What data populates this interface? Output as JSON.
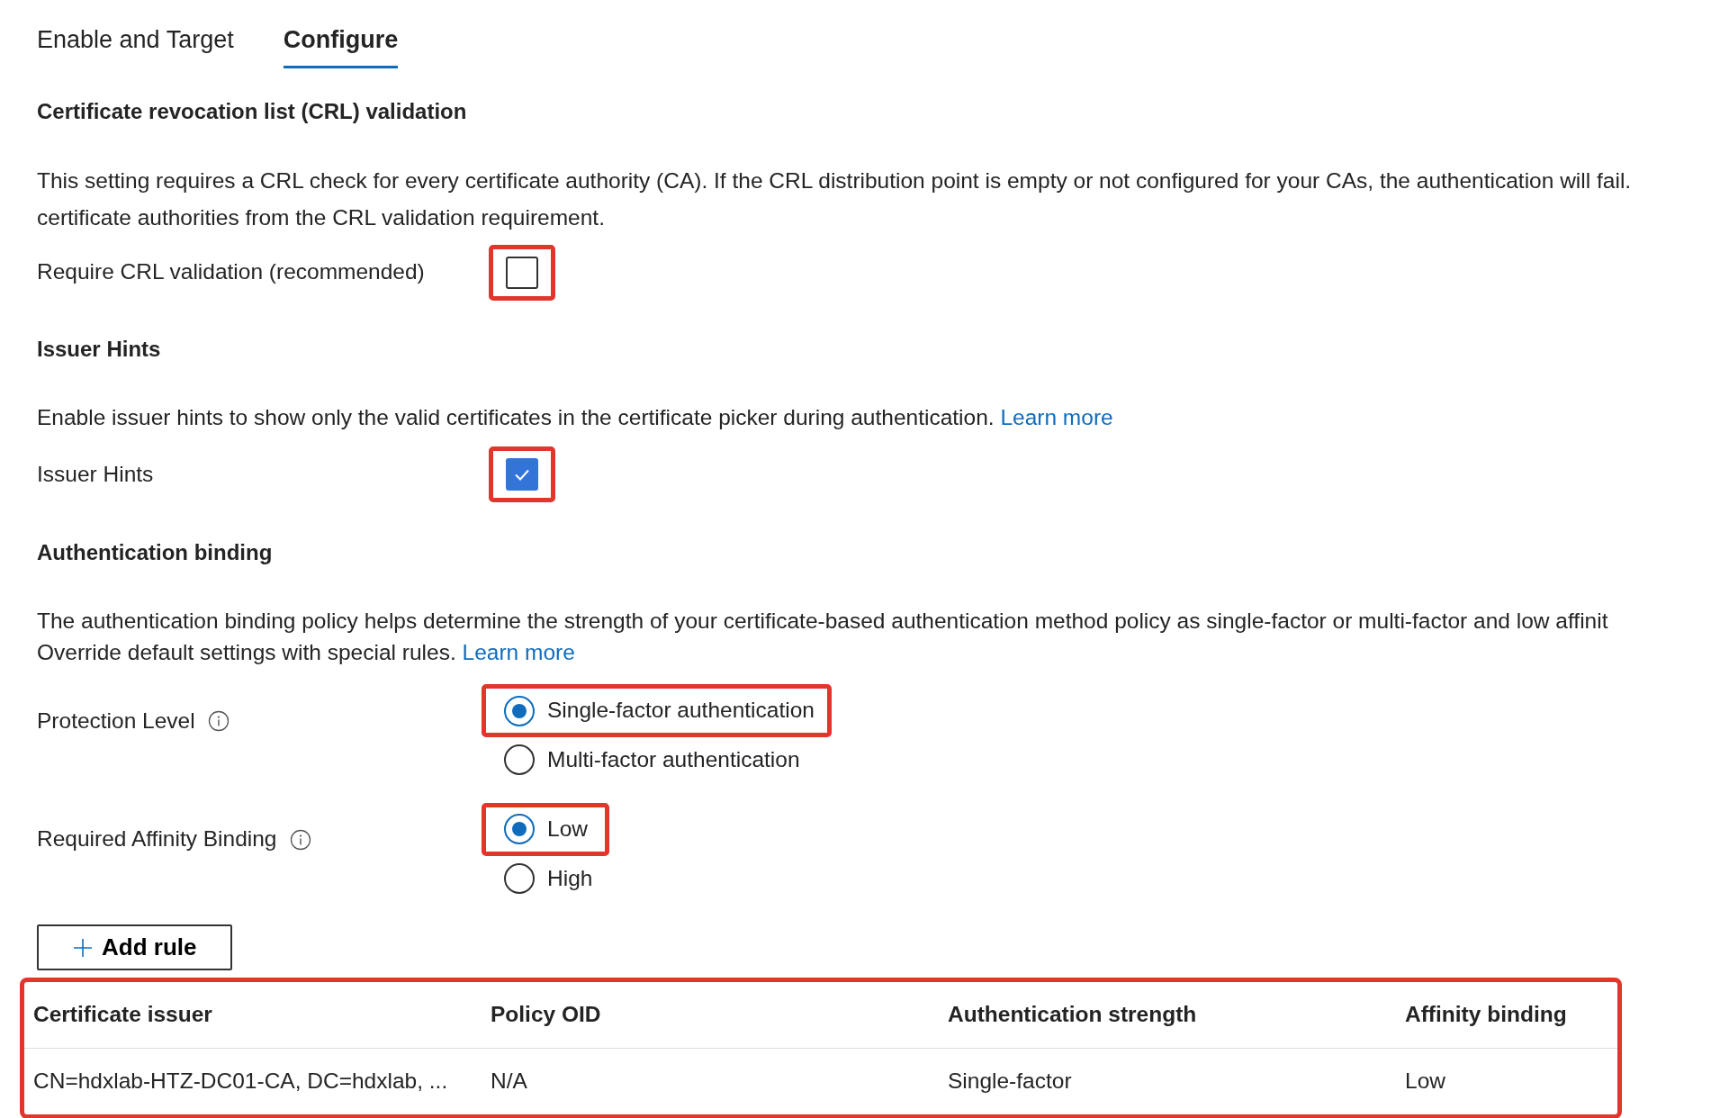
{
  "tabs": [
    {
      "label": "Enable and Target",
      "selected": false
    },
    {
      "label": "Configure",
      "selected": true
    }
  ],
  "crl": {
    "heading": "Certificate revocation list (CRL) validation",
    "lines": [
      "This setting requires a CRL check for every certificate authority (CA). If the CRL distribution point is empty or not configured for your CAs, the authentication will fail.",
      "certificate authorities from the CRL validation requirement."
    ],
    "label": "Require CRL validation (recommended)",
    "checked": false,
    "highlighted": true
  },
  "issuer_hints": {
    "heading": "Issuer Hints",
    "text": "Enable issuer hints to show only the valid certificates in the certificate picker during authentication.",
    "link": "Learn more",
    "label": "Issuer Hints",
    "checked": true,
    "highlighted": true
  },
  "binding": {
    "heading": "Authentication binding",
    "lines": [
      "The authentication binding policy helps determine the strength of your certificate-based authentication method policy as single-factor or multi-factor and low affinit",
      "Override default settings with special rules."
    ],
    "link": "Learn more",
    "groups": [
      {
        "label": "Protection Level",
        "options": [
          {
            "label": "Single-factor authentication",
            "selected": true,
            "highlighted": true
          },
          {
            "label": "Multi-factor authentication",
            "selected": false,
            "highlighted": false
          }
        ]
      },
      {
        "label": "Required Affinity Binding",
        "options": [
          {
            "label": "Low",
            "selected": true,
            "highlighted": true
          },
          {
            "label": "High",
            "selected": false,
            "highlighted": false
          }
        ]
      }
    ]
  },
  "add_rule": "Add rule",
  "table": {
    "highlighted": true,
    "columns": [
      "Certificate issuer",
      "Policy OID",
      "Authentication strength",
      "Affinity binding"
    ],
    "rows": [
      [
        "CN=hdxlab-HTZ-DC01-CA, DC=hdxlab, ...",
        "N/A",
        "Single-factor",
        "Low"
      ]
    ]
  }
}
